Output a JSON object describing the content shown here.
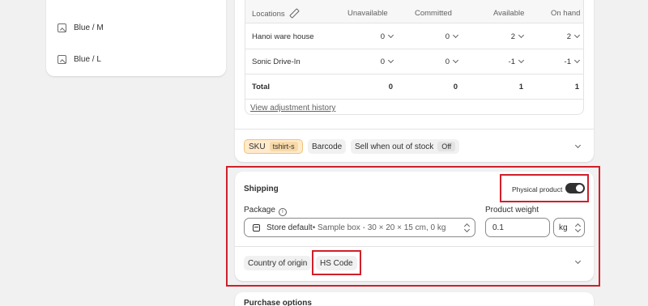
{
  "variants": {
    "items": [
      {
        "label": "Blue / M"
      },
      {
        "label": "Blue / L"
      }
    ]
  },
  "inventory": {
    "columns": {
      "locations": "Locations",
      "unavailable": "Unavailable",
      "committed": "Committed",
      "available": "Available",
      "on_hand": "On hand"
    },
    "rows": [
      {
        "location": "Hanoi ware house",
        "unavailable": "0",
        "committed": "0",
        "available": "2",
        "on_hand": "2"
      },
      {
        "location": "Sonic Drive-In",
        "unavailable": "0",
        "committed": "0",
        "available": "-1",
        "on_hand": "-1"
      }
    ],
    "total": {
      "label": "Total",
      "unavailable": "0",
      "committed": "0",
      "available": "1",
      "on_hand": "1"
    },
    "history_link": "View adjustment history"
  },
  "attributes": {
    "sku_label": "SKU",
    "sku_value": "tshirt-s",
    "barcode": "Barcode",
    "sell_oos_label": "Sell when out of stock",
    "sell_oos_value": "Off"
  },
  "shipping": {
    "title": "Shipping",
    "physical_product_label": "Physical product",
    "physical_product_on": true,
    "package_label": "Package",
    "package_name": "Store default",
    "package_detail": " • Sample box - 30 × 20 × 15 cm, 0 kg",
    "weight_label": "Product weight",
    "weight_value": "0.1",
    "weight_unit": "kg",
    "country_of_origin": "Country of origin",
    "hs_code": "HS Code"
  },
  "purchase_options": {
    "title": "Purchase options"
  },
  "colors": {
    "highlight": "#d0202a",
    "toggle_on": "#303030",
    "sku_badge": "#ffeacc"
  }
}
